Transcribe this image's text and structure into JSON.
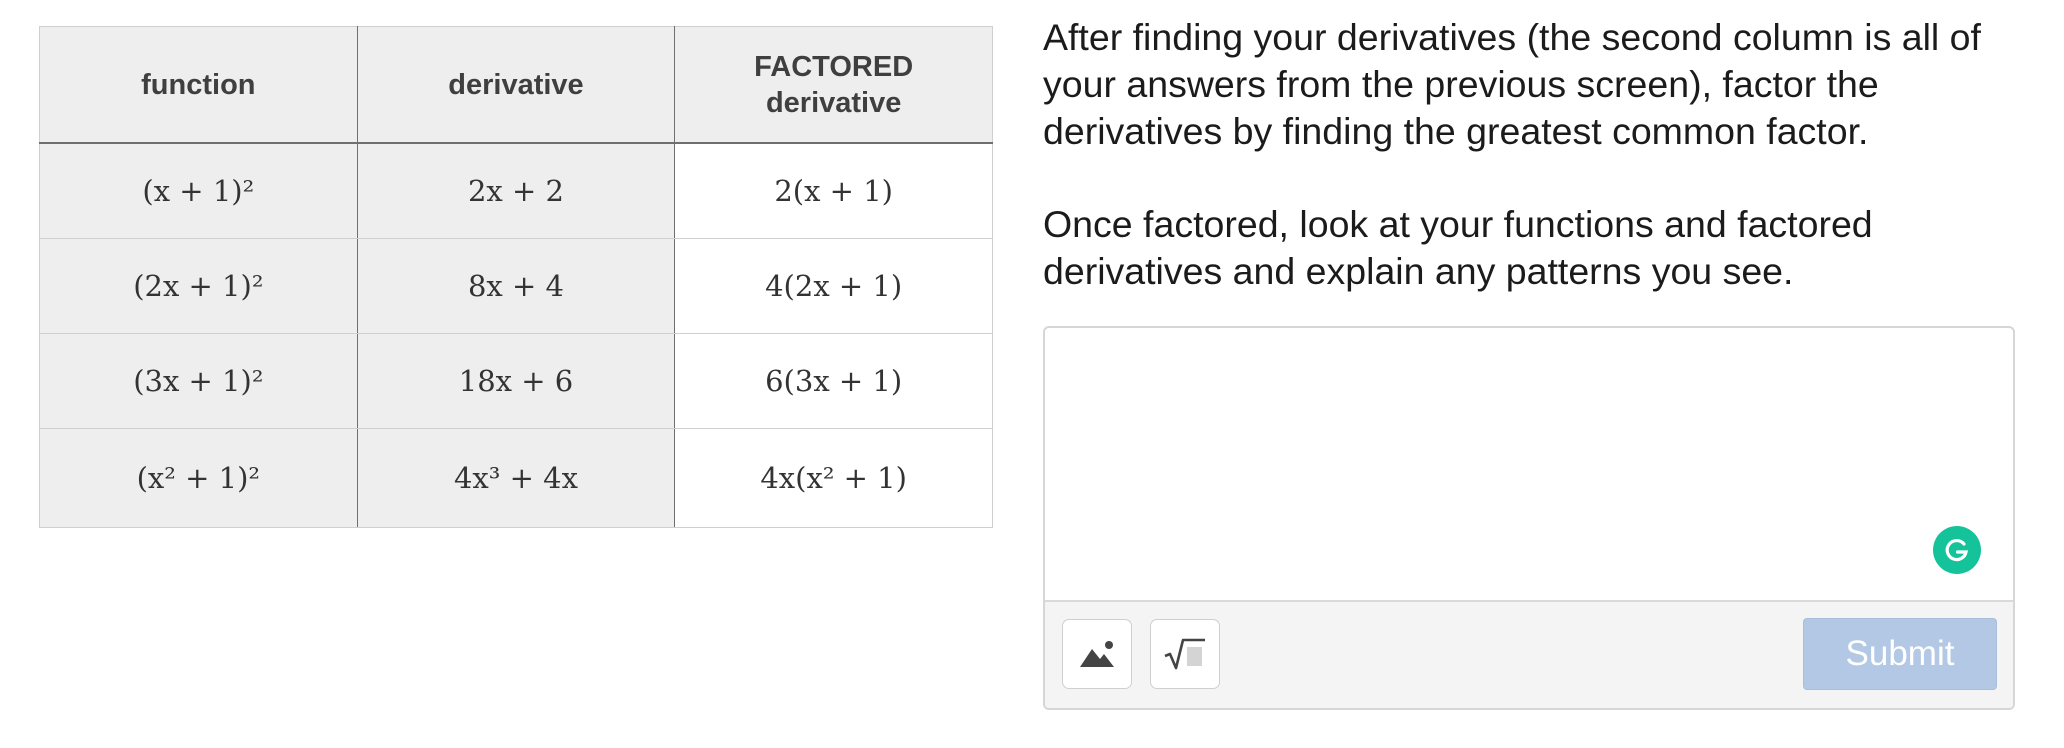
{
  "table": {
    "headers": {
      "function": "function",
      "derivative": "derivative",
      "factored_line1": "FACTORED",
      "factored_line2": "derivative"
    },
    "rows": [
      {
        "function": "(x + 1)²",
        "derivative": "2x + 2",
        "factored": "2(x + 1)"
      },
      {
        "function": "(2x + 1)²",
        "derivative": "8x + 4",
        "factored": "4(2x + 1)"
      },
      {
        "function": "(3x + 1)²",
        "derivative": "18x + 6",
        "factored": "6(3x + 1)"
      },
      {
        "function": "(x² + 1)²",
        "derivative": "4x³ + 4x",
        "factored": "4x(x² + 1)"
      }
    ]
  },
  "prompt": {
    "paragraph1": "After finding your derivatives (the second column is all of your answers from the previous screen), factor the derivatives by finding the greatest common factor.",
    "paragraph2": "Once factored, look at your functions and factored derivatives and explain any patterns you see."
  },
  "response": {
    "value": "",
    "submit_label": "Submit",
    "grammarly_letter": "G",
    "image_icon": "image-icon",
    "math_icon": "square-root-icon",
    "submit_color": "#b3c8e4",
    "grammarly_color": "#15c39a"
  }
}
